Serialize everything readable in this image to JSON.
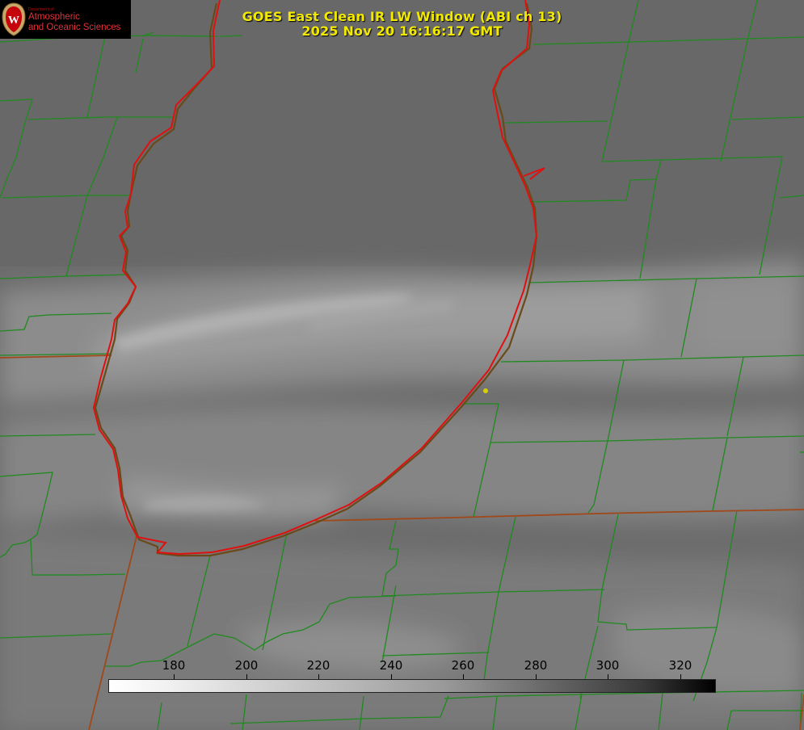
{
  "title": {
    "line1": "GOES East Clean IR LW Window (ABI ch 13)",
    "line2": "2025 Nov 20 16:16:17 GMT"
  },
  "logo": {
    "department": "Department of",
    "line1": "Atmospheric",
    "line2": "and Oceanic Sciences",
    "crest_letter": "W"
  },
  "colorbar": {
    "ticks": [
      "180",
      "200",
      "220",
      "240",
      "260",
      "280",
      "300",
      "320"
    ]
  },
  "colors": {
    "title": "#f2e900",
    "county_lines": "#1f8a1f",
    "state_lines": "#a0481a",
    "coastline": "#e01010",
    "point_marker": "#d8d000",
    "logo_red": "#c5050c"
  }
}
